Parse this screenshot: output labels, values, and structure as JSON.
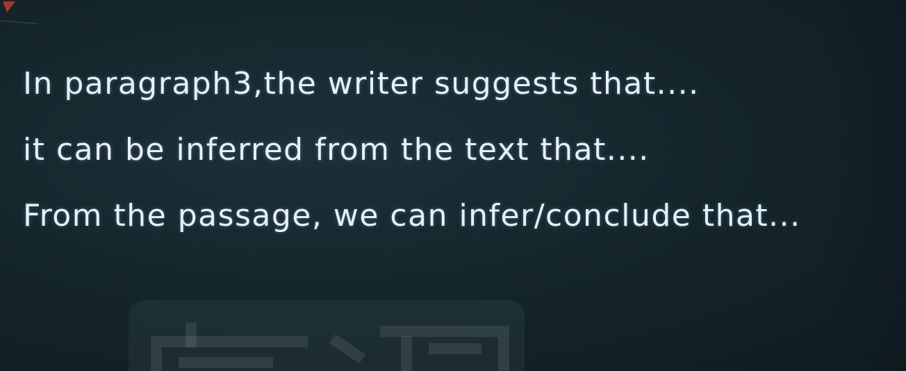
{
  "slide": {
    "lines": [
      "In paragraph3,the writer suggests that....",
      "it can be inferred from the text that....",
      "From the passage, we can infer/conclude that..."
    ]
  },
  "colors": {
    "background": "#16262d",
    "text": "#e6f1fa",
    "corner_mark": "#c0392b"
  },
  "icons": {
    "corner": "red-pin-icon",
    "watermark": "channel-logo-watermark"
  }
}
